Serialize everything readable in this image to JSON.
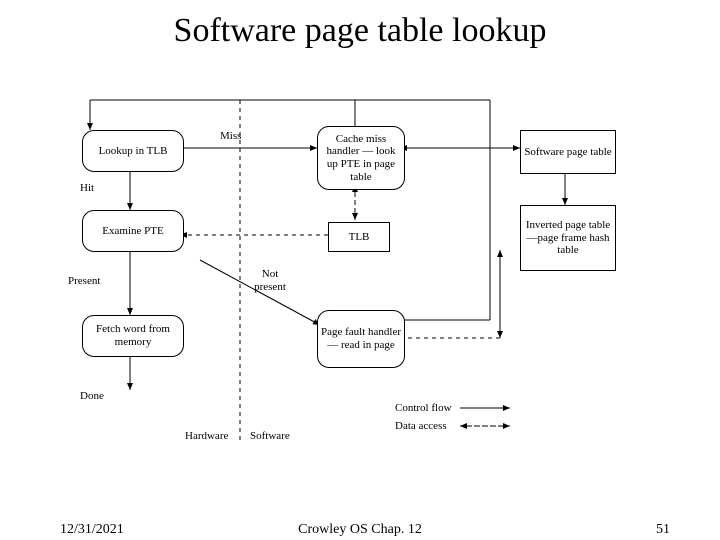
{
  "title": "Software page table lookup",
  "footer": {
    "date": "12/31/2021",
    "center": "Crowley    OS     Chap. 12",
    "page": "51"
  },
  "nodes": {
    "lookup_tlb": "Lookup\nin TLB",
    "examine_pte": "Examine\nPTE",
    "fetch_word": "Fetch word\nfrom memory",
    "cache_miss": "Cache miss\nhandler —\nlook up PTE\nin page table",
    "tlb_box": "TLB",
    "page_fault": "Page fault\nhandler —\nread in page",
    "soft_pt": "Software\npage table",
    "inv_pt": "Inverted page\ntable—page\nframe hash\ntable"
  },
  "labels": {
    "miss": "Miss",
    "hit": "Hit",
    "present": "Present",
    "not_present": "Not\npresent",
    "done": "Done",
    "hardware": "Hardware",
    "software": "Software",
    "control_flow": "Control flow",
    "data_access": "Data access"
  }
}
